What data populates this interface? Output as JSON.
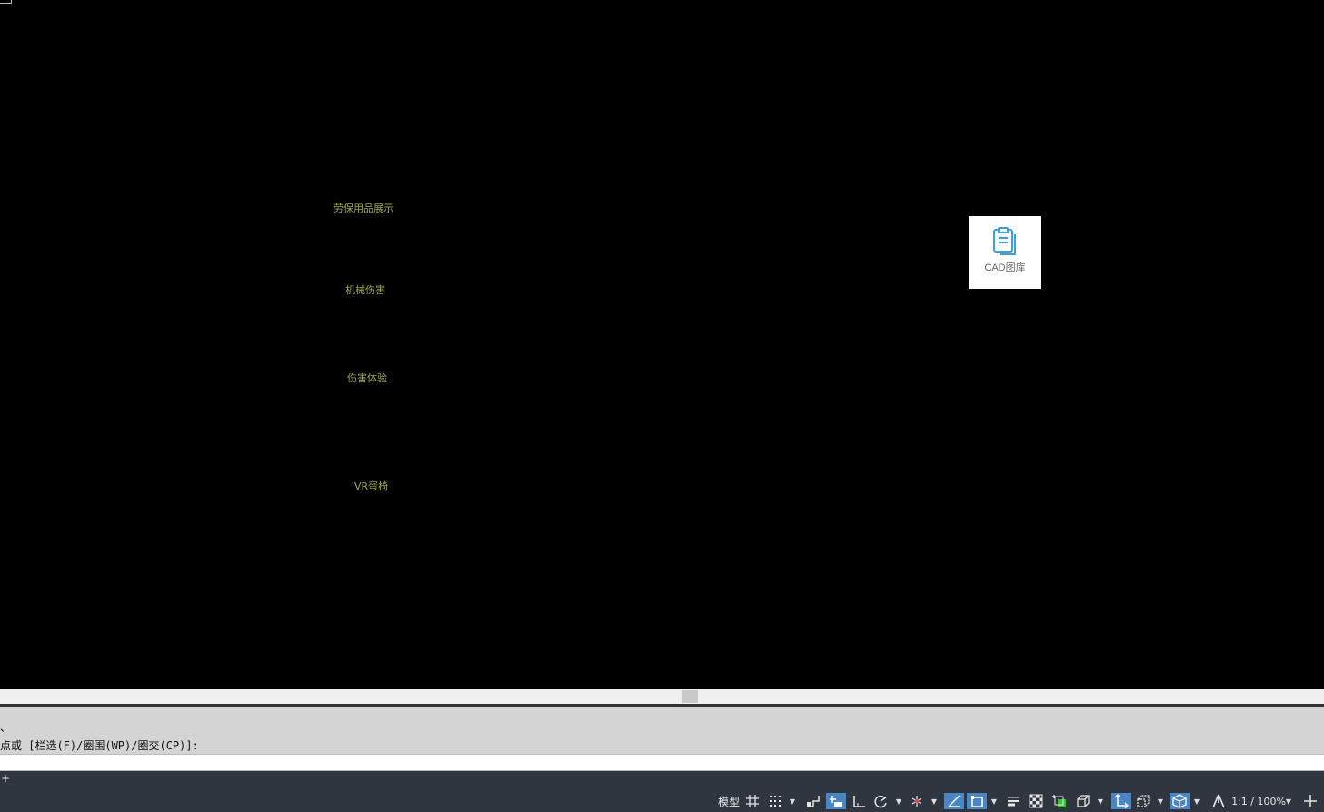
{
  "canvas": {
    "labels": [
      "劳保用品展示",
      "机械伤害",
      "伤害体验",
      "VR蛋椅"
    ],
    "label_color": "#9fa653"
  },
  "library_card": {
    "label": "CAD图库",
    "icon": "clipboard-icon",
    "accent": "#3ea0d6"
  },
  "command": {
    "history_line1": "、",
    "history_line2": "点或 [栏选(F)/圈围(WP)/圈交(CP)]:",
    "input_value": ""
  },
  "status_bar": {
    "model_label": "模型",
    "scale_label": "1:1 / 100%",
    "active_color": "#4a86c5",
    "icons": [
      "grid-icon",
      "snap-icon",
      "infer-icon",
      "dynamic-input-icon",
      "ortho-icon",
      "polar-icon",
      "isodraft-icon",
      "object-snap-tracking-icon",
      "object-snap-icon",
      "lineweight-icon",
      "transparency-icon",
      "selection-cycling-icon",
      "3d-osnap-icon",
      "dynamic-ucs-icon",
      "selection-filter-icon",
      "gizmo-icon",
      "annotation-visibility-icon",
      "annotation-scale-icon",
      "customize-icon"
    ]
  }
}
